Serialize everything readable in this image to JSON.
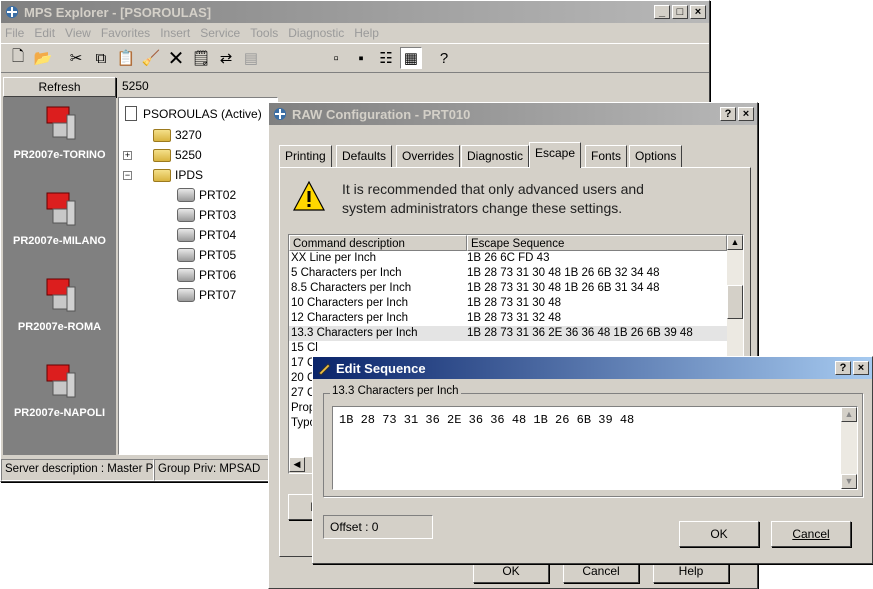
{
  "main_window": {
    "title": "MPS Explorer - [PSOROULAS]",
    "min": "_",
    "max": "□",
    "close": "×",
    "menu": [
      "File",
      "Edit",
      "View",
      "Favorites",
      "Insert",
      "Service",
      "Tools",
      "Diagnostic",
      "Help"
    ],
    "refresh_label": "Refresh",
    "path_label": "5250",
    "servers": [
      "PR2007e-TORINO",
      "PR2007e-MILANO",
      "PR2007e-ROMA",
      "PR2007e-NAPOLI"
    ],
    "tree": {
      "root": "PSOROULAS (Active)",
      "n1": "3270",
      "n2": "5250",
      "n3": "IPDS",
      "printers": [
        "PRT02",
        "PRT03",
        "PRT04",
        "PRT05",
        "PRT06",
        "PRT07"
      ]
    },
    "status": [
      "Server description : Master P",
      "Group Priv: MPSAD"
    ]
  },
  "raw_dialog": {
    "title": "RAW Configuration - PRT010",
    "help": "?",
    "close": "×",
    "tabs": [
      "Printing",
      "Defaults",
      "Overrides",
      "Diagnostic",
      "Escape",
      "Fonts",
      "Options"
    ],
    "warning": "It is recommended that only advanced users and system administrators change these settings.",
    "col1": "Command description",
    "col2": "Escape Sequence",
    "rows": [
      {
        "desc": "XX Line per Inch",
        "seq": "1B 26 6C FD 43"
      },
      {
        "desc": "5 Characters per Inch",
        "seq": "1B 28 73 31 30 48 1B 26 6B 32 34 48"
      },
      {
        "desc": "8.5 Characters per Inch",
        "seq": "1B 28 73 31 30 48 1B 26 6B 31 34 48"
      },
      {
        "desc": "10  Characters per Inch",
        "seq": "1B 28 73 31 30 48"
      },
      {
        "desc": "12 Characters per Inch",
        "seq": "1B 28 73 31 32 48"
      },
      {
        "desc": "13.3 Characters per Inch",
        "seq": "1B 28 73 31 36 2E 36 36 48 1B 26 6B 39 48"
      },
      {
        "desc": "15 Cl",
        "seq": ""
      },
      {
        "desc": "17 Cl",
        "seq": ""
      },
      {
        "desc": "20 Cl",
        "seq": ""
      },
      {
        "desc": "27 Cl",
        "seq": ""
      },
      {
        "desc": "Prop",
        "seq": ""
      },
      {
        "desc": "Typo",
        "seq": ""
      }
    ],
    "partial_button": "De",
    "ok": "OK",
    "cancel": "Cancel",
    "help_btn": "Help"
  },
  "edit_dialog": {
    "title": "Edit Sequence",
    "help": "?",
    "close": "×",
    "group_label": "13.3 Characters per Inch",
    "sequence": "1B 28 73 31 36 2E 36 36 48 1B 26 6B 39 48",
    "offset": "Offset : 0",
    "ok": "OK",
    "cancel": "Cancel"
  }
}
